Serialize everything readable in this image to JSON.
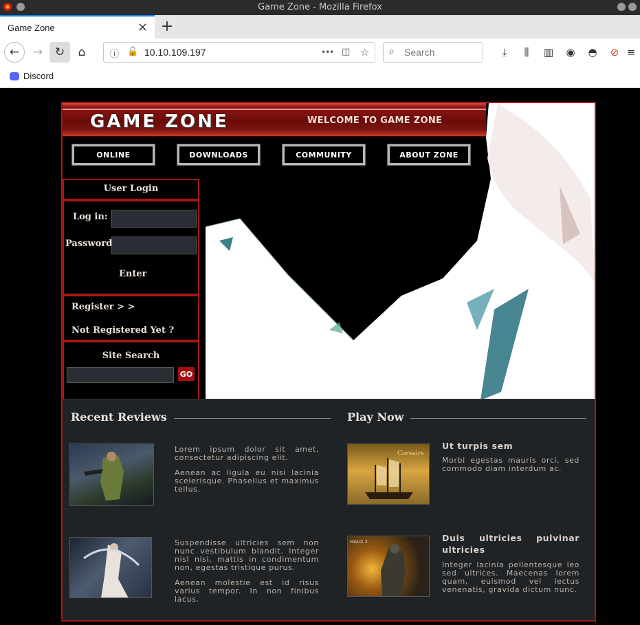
{
  "window": {
    "title": "Game Zone - Mozilla Firefox"
  },
  "tab": {
    "title": "Game Zone",
    "close": "×",
    "new_tab": "+"
  },
  "nav": {
    "url": "10.10.109.197",
    "search_placeholder": "Search",
    "page_actions": "•••"
  },
  "bookmarks": [
    {
      "label": "Discord",
      "icon": "discord-icon"
    }
  ],
  "site": {
    "logo": "GAME ZONE",
    "welcome": "WELCOME TO GAME ZONE",
    "menu": [
      "ONLINE",
      "DOWNLOADS",
      "COMMUNITY",
      "ABOUT ZONE"
    ],
    "login": {
      "title": "User Login",
      "login_label": "Log in:",
      "password_label": "Password:",
      "enter": "Enter",
      "register": "Register > >",
      "not_registered": "Not Registered Yet ?"
    },
    "search": {
      "title": "Site Search",
      "go": "GO"
    },
    "reviews": {
      "title": "Recent Reviews",
      "items": [
        {
          "paragraphs": [
            "Lorem ipsum dolor sit amet, consectetur adipiscing elit.",
            "Aenean ac ligula eu nisi lacinia scelerisque. Phasellus et maximus tellus."
          ]
        },
        {
          "paragraphs": [
            "Suspendisse ultricies sem non nunc vestibulum blandit. Integer nisl nisi, mattis in condimentum non, egestas tristique purus.",
            "Aenean molestie est id risus varius tempor. In non finibus lacus."
          ]
        }
      ]
    },
    "play": {
      "title": "Play Now",
      "items": [
        {
          "heading": "Ut turpis sem",
          "text": "Morbi egestas mauris orci, sed commodo diam interdum ac.",
          "thumb_label": "Corsairs"
        },
        {
          "heading": "Duis ultricies pulvinar ultricies",
          "text": "Integer lacinia pellentesque leo sed ultrices. Maecenas lorem quam, euismod vel lectus venenatis, gravida dictum nunc.",
          "thumb_label": "HALO 2"
        }
      ]
    }
  },
  "colors": {
    "accent_red": "#a71717",
    "panel_bg": "#202326",
    "tab_highlight": "#0a84ff"
  }
}
